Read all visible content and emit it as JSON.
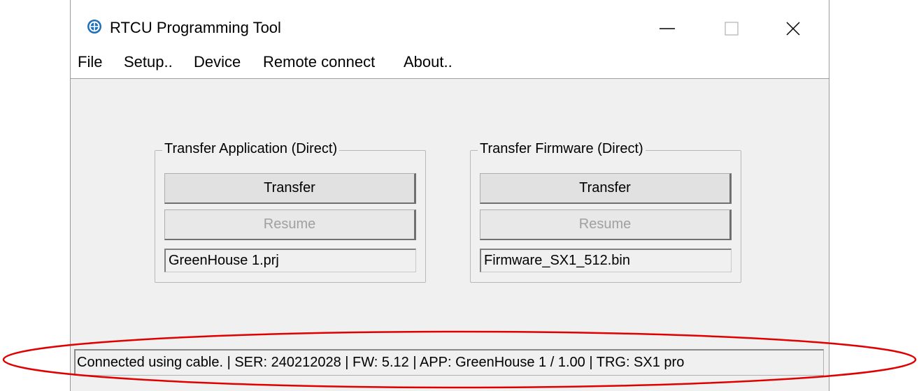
{
  "window": {
    "title": "RTCU Programming Tool",
    "app_icon": "rtcu-globe-icon"
  },
  "title_controls": {
    "minimize_icon": "minimize-icon",
    "maximize_icon": "maximize-icon",
    "close_icon": "close-icon"
  },
  "menu": {
    "items": [
      {
        "label": "File"
      },
      {
        "label": "Setup.."
      },
      {
        "label": "Device"
      },
      {
        "label": "Remote connect"
      },
      {
        "label": "About.."
      }
    ]
  },
  "transfer_application": {
    "group_label": "Transfer Application (Direct)",
    "transfer_label": "Transfer",
    "resume_label": "Resume",
    "file_name": "GreenHouse 1.prj"
  },
  "transfer_firmware": {
    "group_label": "Transfer Firmware (Direct)",
    "transfer_label": "Transfer",
    "resume_label": "Resume",
    "file_name": "Firmware_SX1_512.bin"
  },
  "status_bar": {
    "text": "Connected using cable. | SER: 240212028 | FW: 5.12 | APP: GreenHouse 1 / 1.00 | TRG: SX1 pro"
  },
  "colors": {
    "window_bg": "#f0f0f0",
    "annotation": "#e00000",
    "app_icon": "#1e6fb8"
  }
}
